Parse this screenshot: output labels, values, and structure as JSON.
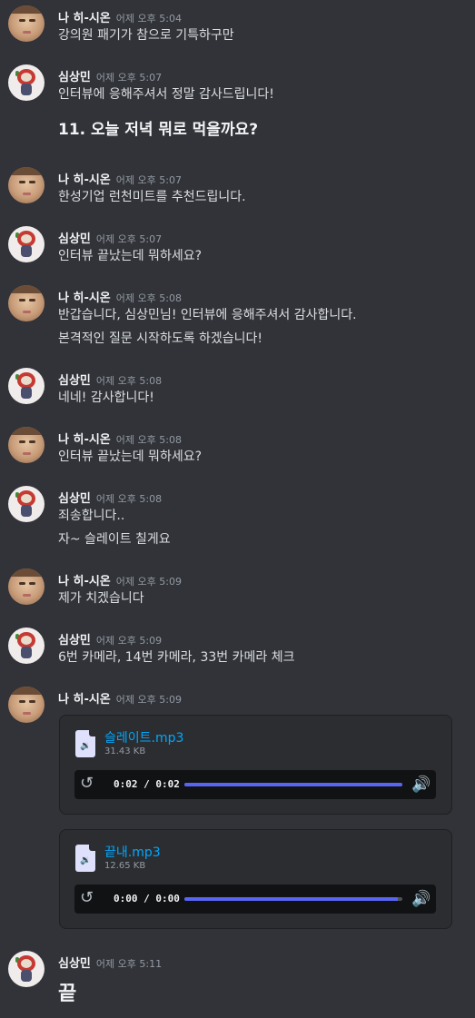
{
  "users": {
    "nahee": {
      "name": "나 히-시온",
      "avatar_icon": "face-photo-avatar"
    },
    "sim": {
      "name": "심상민",
      "avatar_icon": "cartoon-character-avatar"
    }
  },
  "messages": [
    {
      "user": "나 히-시온",
      "time": "어제 오후 5:04",
      "lines": [
        "강의원 패기가 참으로 기특하구만"
      ]
    },
    {
      "user": "심상민",
      "time": "어제 오후 5:07",
      "lines": [
        "인터뷰에 응해주셔서 정말 감사드립니다!",
        "11. 오늘 저녁 뭐로 먹을까요?"
      ]
    },
    {
      "user": "나 히-시온",
      "time": "어제 오후 5:07",
      "lines": [
        "한성기업 런천미트를 추천드립니다."
      ]
    },
    {
      "user": "심상민",
      "time": "어제 오후 5:07",
      "lines": [
        "인터뷰 끝났는데 뭐하세요?"
      ]
    },
    {
      "user": "나 히-시온",
      "time": "어제 오후 5:08",
      "lines": [
        "반갑습니다, 심상민님! 인터뷰에 응해주셔서 감사합니다.",
        "본격적인 질문 시작하도록 하겠습니다!"
      ]
    },
    {
      "user": "심상민",
      "time": "어제 오후 5:08",
      "lines": [
        "네네! 감사합니다!"
      ]
    },
    {
      "user": "나 히-시온",
      "time": "어제 오후 5:08",
      "lines": [
        "인터뷰 끝났는데 뭐하세요?"
      ]
    },
    {
      "user": "심상민",
      "time": "어제 오후 5:08",
      "lines": [
        "죄송합니다..",
        "자~ 슬레이트 칠게요"
      ]
    },
    {
      "user": "나 히-시온",
      "time": "어제 오후 5:09",
      "lines": [
        "제가 치겠습니다"
      ]
    },
    {
      "user": "심상민",
      "time": "어제 오후 5:09",
      "lines": [
        "6번 카메라, 14번 카메라, 33번 카메라 체크"
      ]
    },
    {
      "user": "나 히-시온",
      "time": "어제 오후 5:09",
      "lines": []
    },
    {
      "user": "심상민",
      "time": "어제 오후 5:11",
      "lines": [
        "끝"
      ]
    }
  ],
  "attachments": [
    {
      "filename": "슬레이트.mp3",
      "size": "31.43 KB",
      "time_display": "0:02 / 0:02",
      "progress": 1.0,
      "file_icon": "audio-file-icon"
    },
    {
      "filename": "끝내.mp3",
      "size": "12.65 KB",
      "time_display": "0:00 / 0:00",
      "progress": 0.98,
      "file_icon": "audio-file-icon"
    }
  ],
  "colors": {
    "background": "#313338",
    "attachment_bg": "#2b2d31",
    "link": "#00a8fc",
    "accent": "#5865f2",
    "username": "#f2f3f5",
    "timestamp": "#949ba4"
  }
}
